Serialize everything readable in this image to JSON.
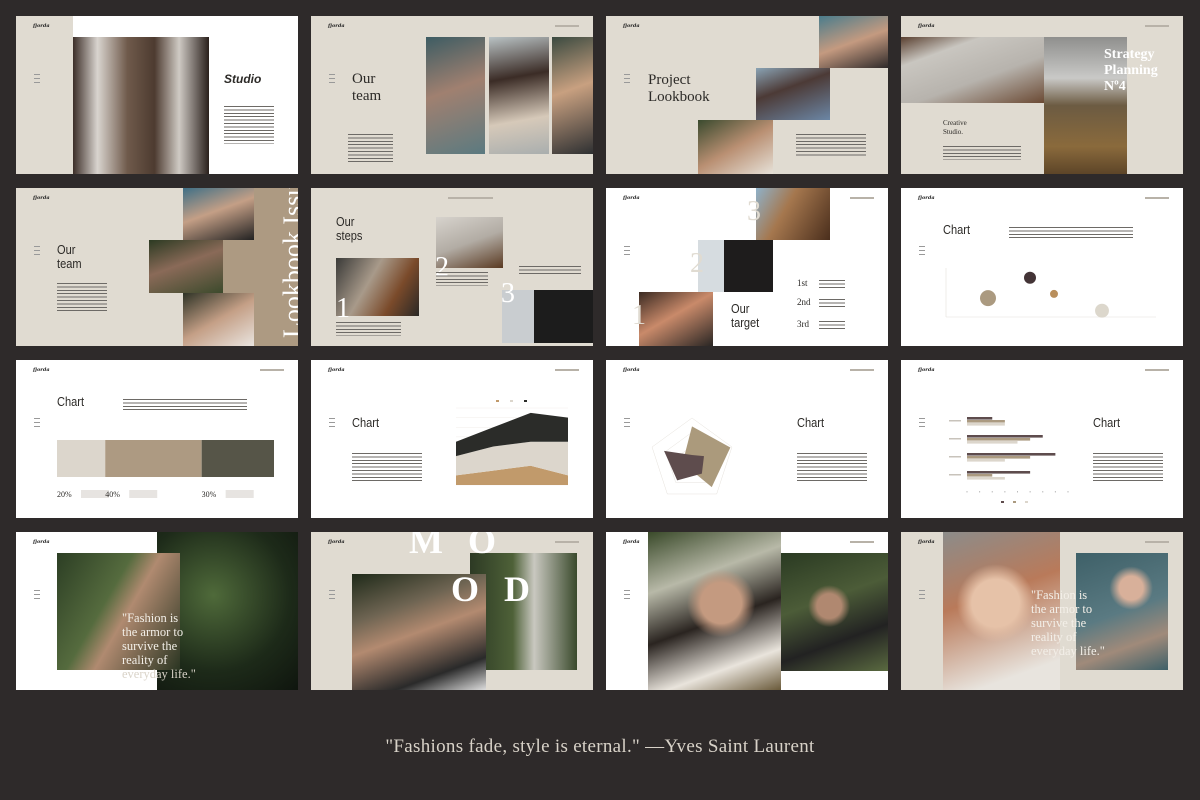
{
  "brand": "fjorda",
  "footer_quote": "\"Fashions fade, style is eternal.\" —Yves Saint Laurent",
  "slides": {
    "studio": {
      "title": "Studio"
    },
    "our_team": {
      "title_lines": [
        "Our",
        "team"
      ]
    },
    "project_lookbook": {
      "title_lines": [
        "Project",
        "Lookbook"
      ]
    },
    "strategy": {
      "title_lines": [
        "Strategy",
        "Planning",
        "Nº4"
      ],
      "subtitle_lines": [
        "Creative",
        "Studio."
      ]
    },
    "team_lookbook": {
      "title_lines": [
        "Our",
        "team"
      ],
      "vertical_text": "Lookbook Issue"
    },
    "our_steps": {
      "title_lines": [
        "Our",
        "steps"
      ],
      "numbers": [
        "1",
        "2",
        "3"
      ]
    },
    "our_target": {
      "title_lines": [
        "Our",
        "target"
      ],
      "numbers": [
        "1",
        "2",
        "3"
      ],
      "ranks": [
        "1st",
        "2nd",
        "3rd"
      ]
    },
    "chart_bubble": {
      "title": "Chart"
    },
    "chart_percent": {
      "title": "Chart"
    },
    "chart_area": {
      "title": "Chart"
    },
    "chart_radar": {
      "title": "Chart"
    },
    "chart_bars": {
      "title": "Chart"
    },
    "quote_plants": {
      "quote_lines": [
        "\"Fashion is",
        "the armor to",
        "survive the",
        "reality of",
        "everyday life.\""
      ]
    },
    "mood": {
      "letters_top": "M O",
      "letters_bottom": "O D"
    },
    "portraits": {},
    "quote_portrait": {
      "quote_lines": [
        "\"Fashion is",
        "the armor to",
        "survive the",
        "reality of",
        "everyday life.\""
      ]
    }
  },
  "colors": {
    "beige": "#e0dbd1",
    "taupe": "#ad9a82",
    "dark": "#2e2a2a"
  },
  "chart_data": [
    {
      "id": "bubble",
      "type": "scatter",
      "variant": "bubble",
      "xlim": [
        0,
        7
      ],
      "ylim": [
        0,
        7
      ],
      "grid": false,
      "points": [
        {
          "x": 1.4,
          "y": 2.7,
          "size": 16,
          "color": "#ab9a80"
        },
        {
          "x": 2.8,
          "y": 5.6,
          "size": 9,
          "color": "#433436"
        },
        {
          "x": 3.6,
          "y": 3.3,
          "size": 4,
          "color": "#b98f5c"
        },
        {
          "x": 5.2,
          "y": 0.9,
          "size": 12,
          "color": "#dcd7cc"
        }
      ]
    },
    {
      "id": "percent",
      "type": "bar",
      "variant": "stacked-100",
      "values": [
        20,
        40,
        30
      ],
      "labels": [
        "20%",
        "40%",
        "30%"
      ],
      "colors": [
        "#dcd6cc",
        "#ad9a82",
        "#565548"
      ]
    },
    {
      "id": "area",
      "type": "area",
      "stacked": true,
      "ylim": [
        0,
        8
      ],
      "grid": true,
      "series": [
        {
          "values": [
            1,
            1.5,
            2,
            1
          ],
          "color": "#c19a6b"
        },
        {
          "values": [
            2,
            2.5,
            2.5,
            3.5
          ],
          "color": "#dcd6cc"
        },
        {
          "values": [
            1.5,
            2,
            3,
            2.5
          ],
          "color": "#2b2c29"
        }
      ]
    },
    {
      "id": "radar",
      "type": "radar",
      "rmax": 5,
      "series": [
        {
          "values": [
            4,
            4.8,
            4,
            1,
            1
          ],
          "color": "#ab9a7c"
        },
        {
          "values": [
            0.6,
            1.5,
            2,
            3,
            3.5
          ],
          "color": "#5e4c4d"
        }
      ]
    },
    {
      "id": "hbars",
      "type": "bar",
      "orientation": "horizontal",
      "xlim": [
        0,
        8
      ],
      "series": [
        {
          "values": [
            5,
            7,
            6,
            2
          ],
          "color": "#5e4c4d"
        },
        {
          "values": [
            2,
            5,
            5,
            3
          ],
          "color": "#ab9a80"
        },
        {
          "values": [
            3,
            3,
            4,
            3
          ],
          "color": "#dcd6cc"
        }
      ]
    }
  ]
}
